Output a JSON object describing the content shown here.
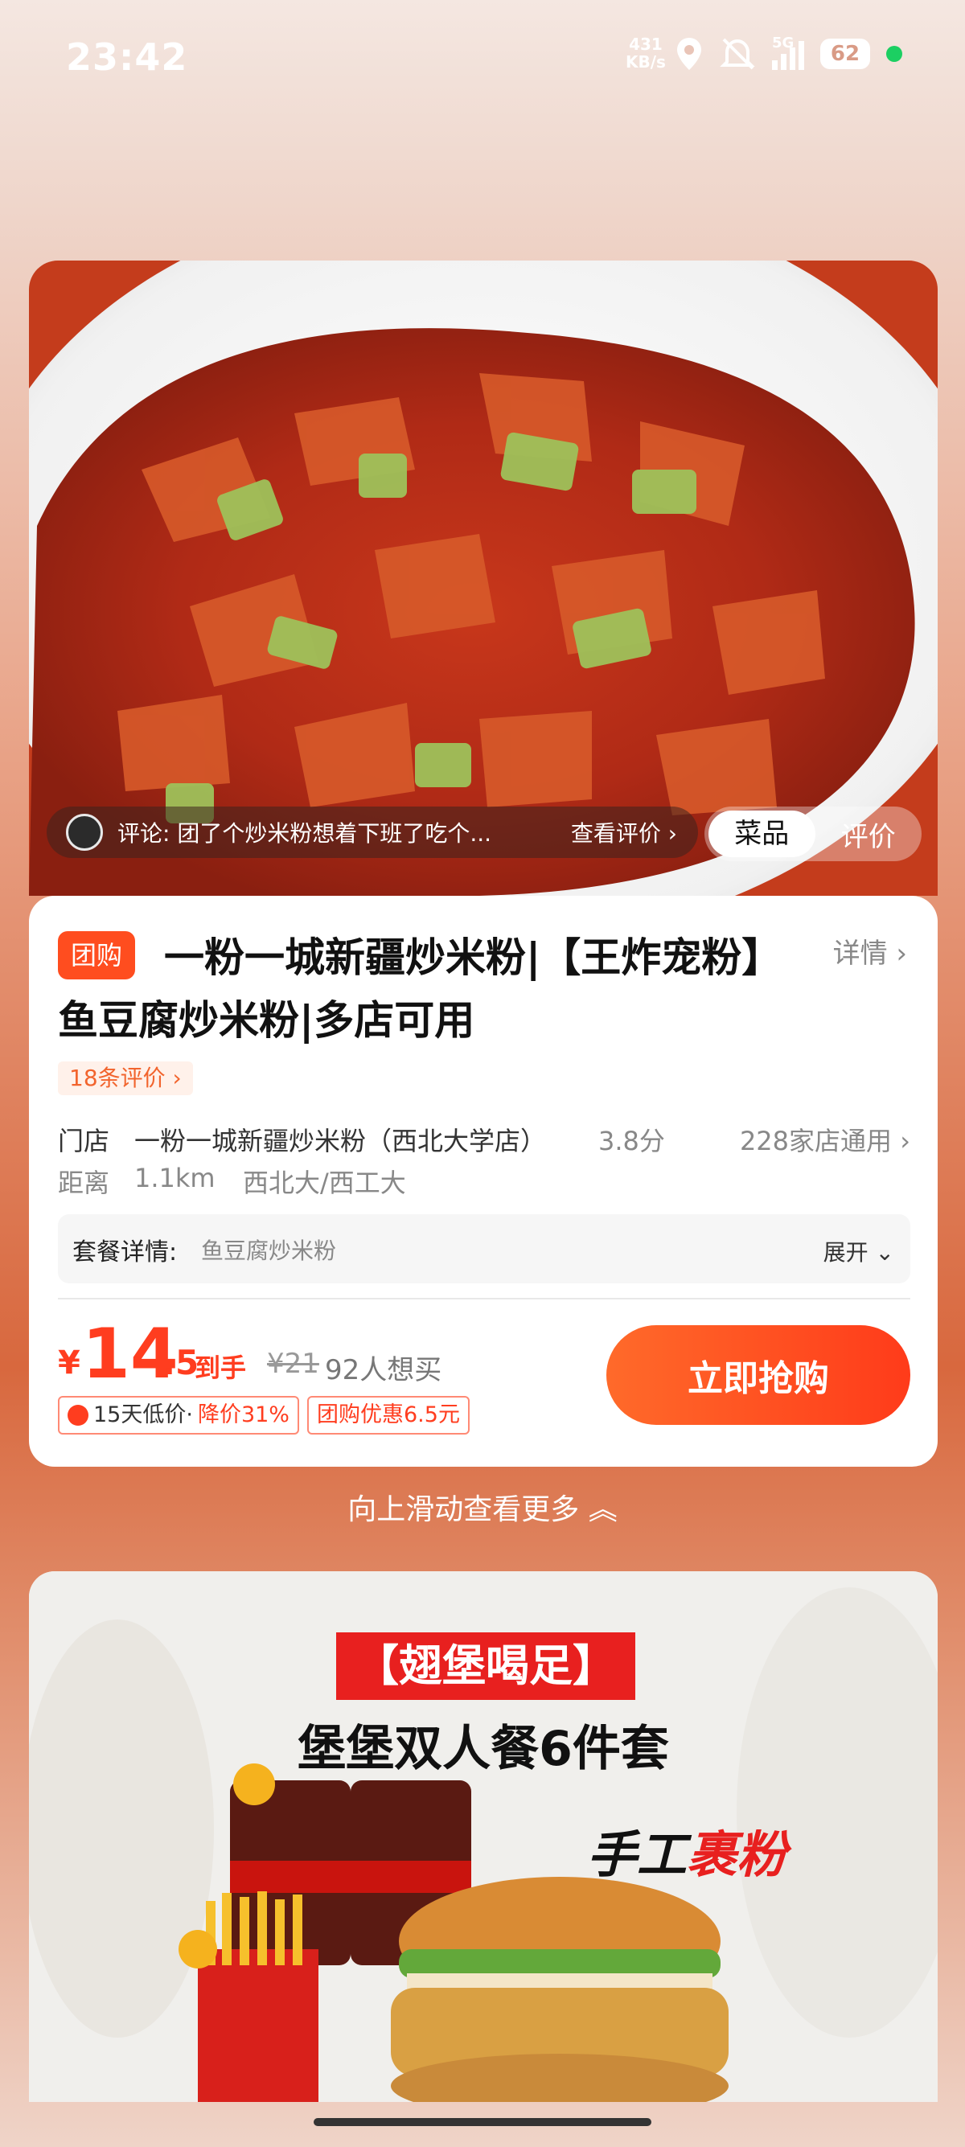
{
  "status_bar": {
    "time": "23:42",
    "net_speed_value": "431",
    "net_speed_unit": "KB/s",
    "signal": "5G",
    "battery": "62"
  },
  "hero": {
    "review_text": "评论: 团了个炒米粉想着下班了吃个...",
    "review_link": "查看评价",
    "segments": [
      "菜品",
      "评价"
    ],
    "active_segment": 0
  },
  "deal": {
    "badge": "团购",
    "title": "一粉一城新疆炒米粉|【王炸宠粉】鱼豆腐炒米粉|多店可用",
    "detail_link": "详情",
    "review_count": "18条评价",
    "store_label": "门店",
    "store_name": "一粉一城新疆炒米粉（西北大学店）",
    "rating": "3.8分",
    "store_count": "228家店通用",
    "distance_label": "距离",
    "distance": "1.1km",
    "area": "西北大/西工大",
    "package_label": "套餐详情:",
    "package_value": "鱼豆腐炒米粉",
    "expand": "展开",
    "currency": "¥",
    "price_int": "14",
    "price_dec": ".5",
    "price_suffix": "到手",
    "original_price": "¥21",
    "wants": "92人想买",
    "buy_button": "立即抢购",
    "low_price_tag": "15天低价",
    "low_price_sep": "·",
    "low_price_drop": "降价31%",
    "discount_tag": "团购优惠6.5元"
  },
  "swipe_hint": "向上滑动查看更多",
  "promo": {
    "badge": "【翅堡喝足】",
    "title": "堡堡双人餐6件套",
    "hand_1": "手工",
    "hand_2": "裹粉"
  },
  "colors": {
    "accent": "#ff3d1f",
    "button_start": "#ff6a2a",
    "button_end": "#ff3b1a",
    "tag_bg": "#fff1ea"
  }
}
